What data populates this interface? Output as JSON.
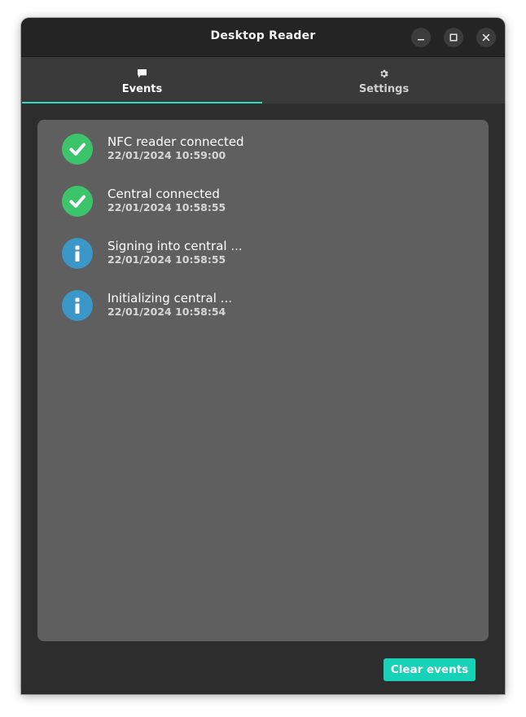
{
  "window": {
    "title": "Desktop Reader"
  },
  "tabs": [
    {
      "label": "Events",
      "icon": "chat-bubble-icon",
      "active": true
    },
    {
      "label": "Settings",
      "icon": "gear-icon",
      "active": false
    }
  ],
  "events": [
    {
      "title": "NFC reader connected",
      "timestamp": "22/01/2024 10:59:00",
      "type": "success"
    },
    {
      "title": "Central connected",
      "timestamp": "22/01/2024 10:58:55",
      "type": "success"
    },
    {
      "title": "Signing into central ...",
      "timestamp": "22/01/2024 10:58:55",
      "type": "info"
    },
    {
      "title": "Initializing central ...",
      "timestamp": "22/01/2024 10:58:54",
      "type": "info"
    }
  ],
  "actions": {
    "clear_label": "Clear events"
  },
  "colors": {
    "accent": "#18d2b8",
    "success": "#3bc46a",
    "info": "#3a97c8"
  }
}
